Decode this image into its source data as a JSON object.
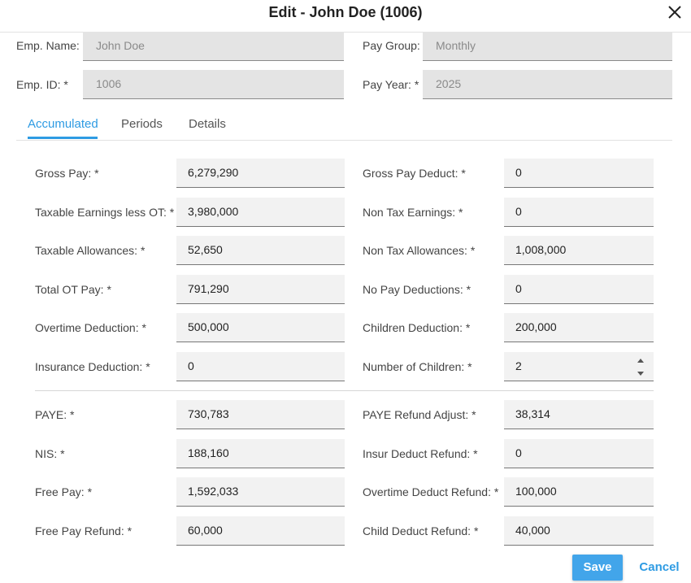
{
  "dialog": {
    "title": "Edit - John Doe (1006)",
    "close_icon": "close-icon"
  },
  "employee": {
    "name_label": "Emp. Name:",
    "name_value": "John Doe",
    "id_label": "Emp. ID: *",
    "id_value": "1006",
    "pay_group_label": "Pay Group:",
    "pay_group_value": "Monthly",
    "pay_year_label": "Pay Year: *",
    "pay_year_value": "2025"
  },
  "tabs": [
    {
      "label": "Accumulated",
      "active": true
    },
    {
      "label": "Periods",
      "active": false
    },
    {
      "label": "Details",
      "active": false
    }
  ],
  "fields_left": [
    {
      "label": "Gross Pay: *",
      "value": "6,279,290"
    },
    {
      "label": "Taxable Earnings less OT: *",
      "value": "3,980,000"
    },
    {
      "label": "Taxable Allowances: *",
      "value": "52,650"
    },
    {
      "label": "Total OT Pay: *",
      "value": "791,290"
    },
    {
      "label": "Overtime Deduction: *",
      "value": "500,000"
    },
    {
      "label": "Insurance Deduction: *",
      "value": "0"
    },
    {
      "label": "PAYE: *",
      "value": "730,783"
    },
    {
      "label": "NIS: *",
      "value": "188,160"
    },
    {
      "label": "Free Pay: *",
      "value": "1,592,033"
    },
    {
      "label": "Free Pay Refund: *",
      "value": "60,000"
    }
  ],
  "fields_right": [
    {
      "label": "Gross Pay Deduct: *",
      "value": "0"
    },
    {
      "label": "Non Tax Earnings: *",
      "value": "0"
    },
    {
      "label": "Non Tax Allowances: *",
      "value": "1,008,000"
    },
    {
      "label": "No Pay Deductions: *",
      "value": "0"
    },
    {
      "label": "Children Deduction: *",
      "value": "200,000"
    },
    {
      "label": "Number of Children: *",
      "value": "2"
    },
    {
      "label": "PAYE Refund Adjust: *",
      "value": "38,314"
    },
    {
      "label": "Insur Deduct Refund: *",
      "value": "0"
    },
    {
      "label": "Overtime Deduct Refund: *",
      "value": "100,000"
    },
    {
      "label": "Child Deduct Refund: *",
      "value": "40,000"
    }
  ],
  "actions": {
    "save_label": "Save",
    "cancel_label": "Cancel"
  },
  "colors": {
    "accent": "#2e9be3",
    "save_button": "#42a5ea",
    "readonly_field": "#e4e4e4",
    "input_field": "#f2f2f2"
  }
}
